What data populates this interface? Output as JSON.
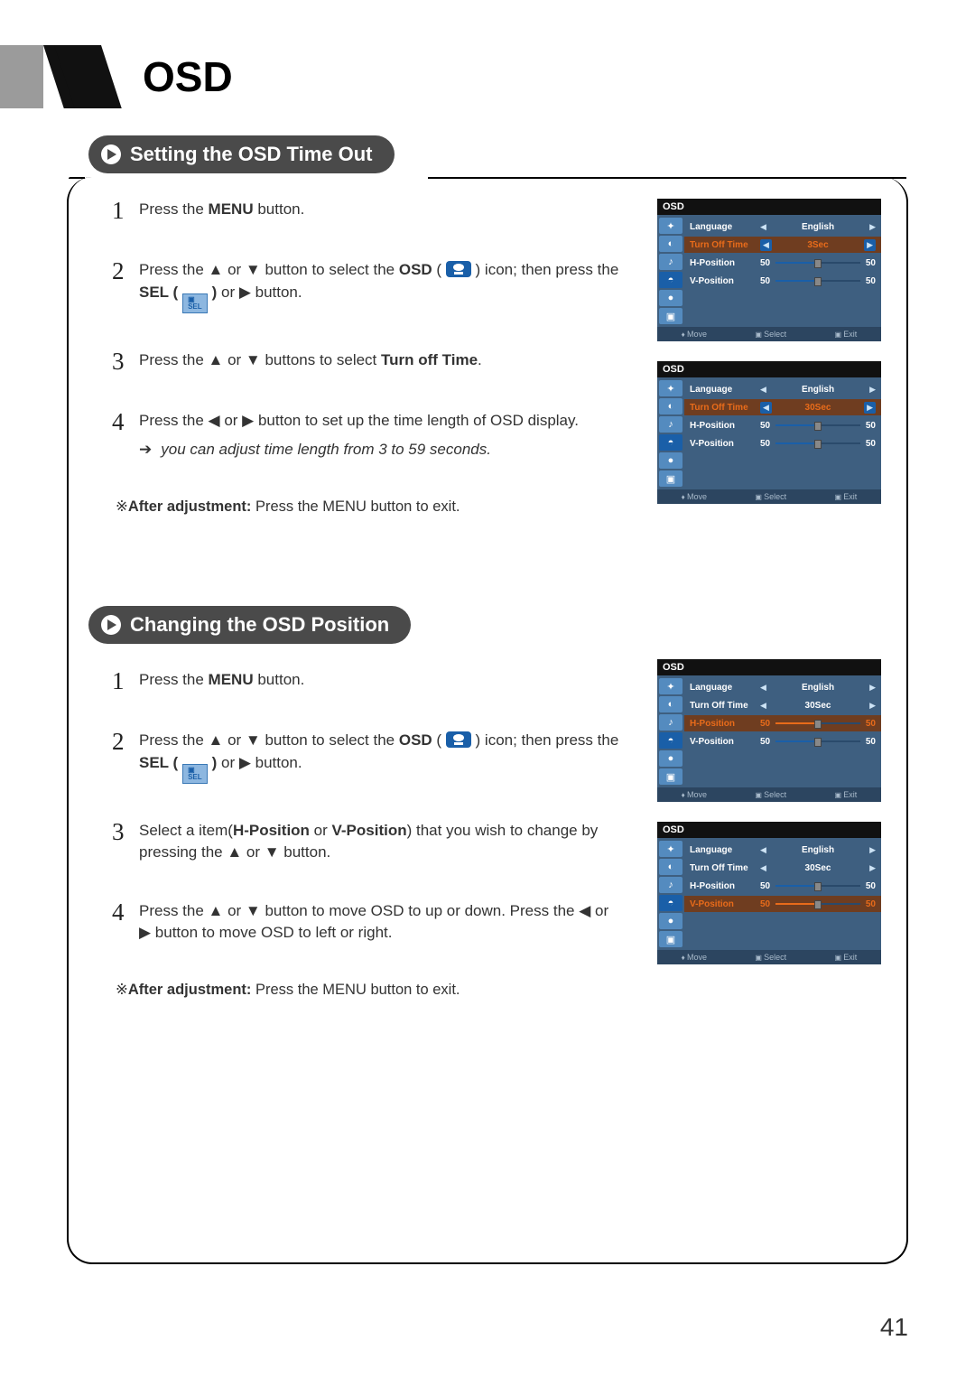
{
  "header": {
    "title": "OSD"
  },
  "page_number": "41",
  "section1": {
    "heading": "Setting the OSD Time Out",
    "steps": [
      {
        "n": "1",
        "pre": "Press the ",
        "bold1": "MENU",
        "post": " button."
      },
      {
        "n": "2",
        "frag": [
          "Press the ▲ or ▼ button to select the ",
          "OSD",
          " ( ",
          "OSDICON",
          " ) icon; then press the ",
          "SEL ( ",
          "SELICON",
          " )",
          " or ▶ button."
        ]
      },
      {
        "n": "3",
        "frag": [
          "Press the ▲ or ▼ buttons to select ",
          "Turn off Time",
          "."
        ]
      },
      {
        "n": "4",
        "text": "Press the ◀ or ▶ button to set up the time length of OSD display.",
        "sub": "you can adjust time length from 3 to 59 seconds."
      }
    ],
    "note_prefix": "※",
    "note_bold": "After adjustment:",
    "note_rest": " Press the MENU button to exit."
  },
  "section2": {
    "heading": "Changing the OSD Position",
    "steps": [
      {
        "n": "1",
        "pre": "Press the ",
        "bold1": "MENU",
        "post": " button."
      },
      {
        "n": "2",
        "frag": [
          "Press the ▲ or ▼ button to select the ",
          "OSD",
          " ( ",
          "OSDICON",
          " ) icon; then press the ",
          "SEL ( ",
          "SELICON",
          " )",
          " or ▶ button."
        ]
      },
      {
        "n": "3",
        "frag": [
          "Select a item(",
          "H-Position",
          " or ",
          "V-Position",
          ") that you wish to change by pressing the ▲ or ▼ button."
        ]
      },
      {
        "n": "4",
        "text": "Press the ▲ or ▼ button to move OSD to up or down. Press the ◀ or ▶ button to move OSD to left or right."
      }
    ],
    "note_prefix": "※",
    "note_bold": "After adjustment:",
    "note_rest": " Press the MENU button to exit."
  },
  "osd_common": {
    "title": "OSD",
    "rows": {
      "language": "Language",
      "turnoff": "Turn Off Time",
      "hpos": "H-Position",
      "vpos": "V-Position"
    },
    "values": {
      "english": "English",
      "t3": "3Sec",
      "t30": "30Sec",
      "v50": "50"
    },
    "footer": {
      "move": "Move",
      "select": "Select",
      "exit": "Exit"
    }
  }
}
